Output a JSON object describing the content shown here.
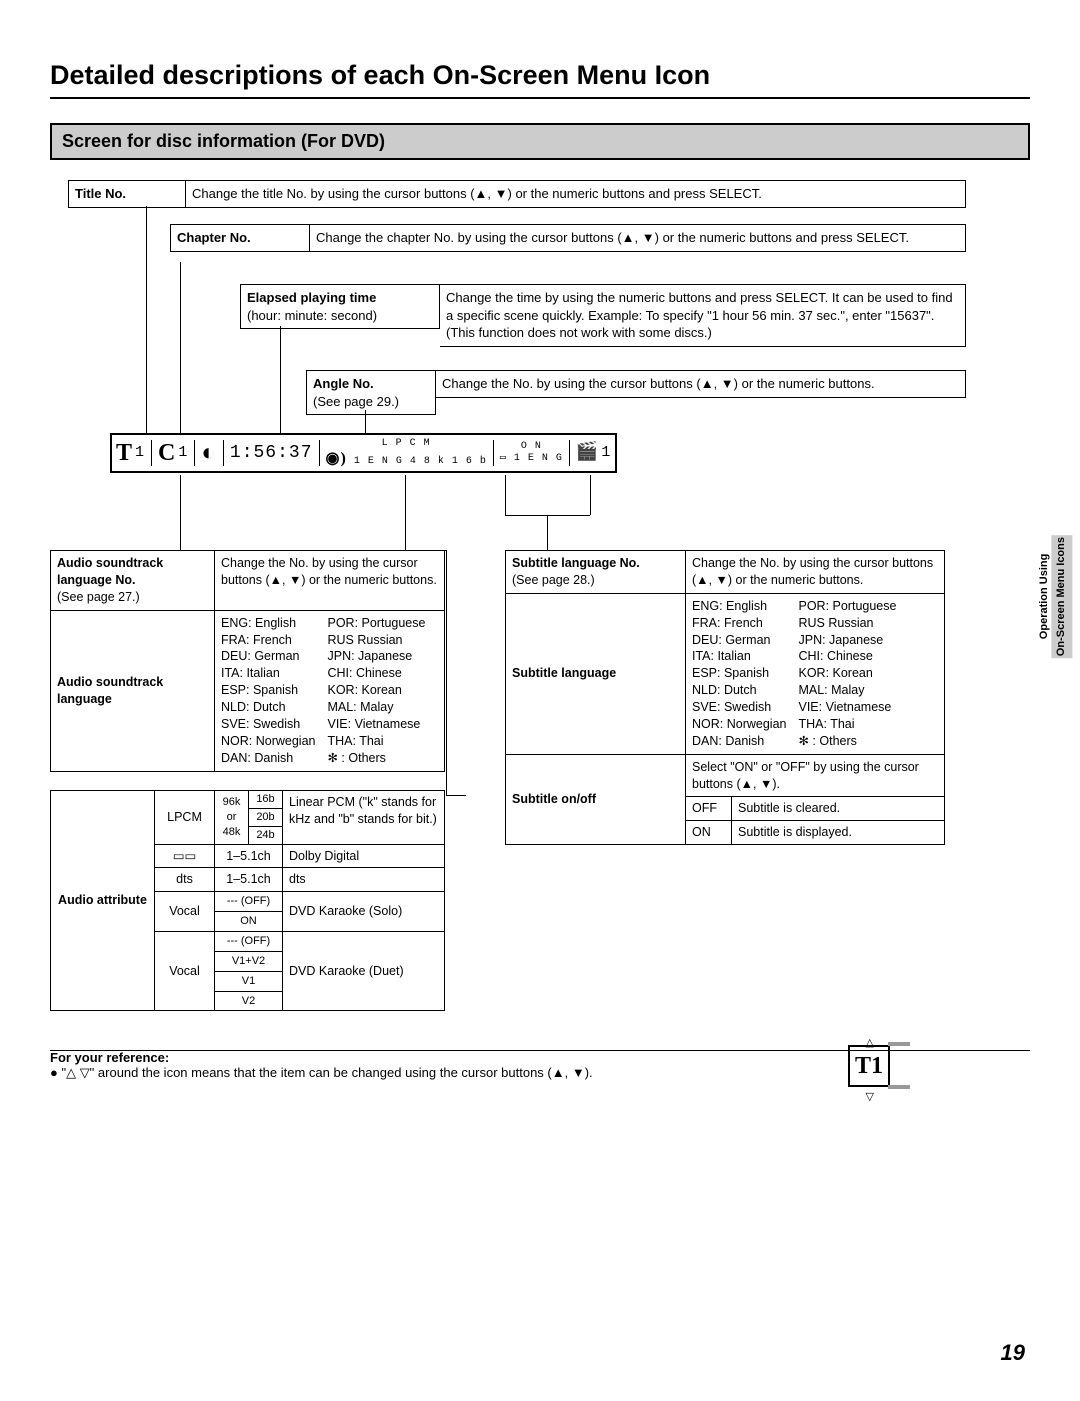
{
  "page_title": "Detailed descriptions of each On-Screen Menu Icon",
  "section_title": "Screen for disc information (For DVD)",
  "side_tab": {
    "line1": "Operation Using",
    "line2": "On-Screen Menu Icons"
  },
  "title_no": {
    "label": "Title No.",
    "desc": "Change the title No. by using the cursor buttons (▲, ▼) or the numeric buttons and press SELECT."
  },
  "chapter_no": {
    "label": "Chapter No.",
    "desc": "Change the chapter No. by using the cursor buttons (▲, ▼) or the numeric buttons and press SELECT."
  },
  "elapsed": {
    "label": "Elapsed playing time",
    "sub": "(hour: minute: second)",
    "desc": "Change the time by using the numeric buttons and press SELECT. It can be used to find a specific scene quickly. Example:  To specify \"1 hour 56 min. 37 sec.\", enter \"15637\". (This function does not work with some discs.)"
  },
  "angle": {
    "label": "Angle No.",
    "sub": "(See page 29.)",
    "desc": "Change the No. by using the cursor buttons (▲, ▼) or the numeric buttons."
  },
  "osd": {
    "t": "T",
    "t_val": "1",
    "c": "C",
    "c_val": "1",
    "angle_icon": "◐",
    "time": "1:56:37",
    "aud_icon": "◉)",
    "top_line": "L P C M",
    "aud_line": "1  E N G   4 8 k   1 6 b",
    "sub_on": "O N",
    "sub_lang": "1  E N G",
    "sub_icon": "▭",
    "s_val": "1"
  },
  "audio_no": {
    "label": "Audio soundtrack language No.",
    "sub": "(See page 27.)",
    "desc": "Change the No. by using the cursor buttons (▲, ▼) or the numeric buttons."
  },
  "audio_lang": {
    "label": "Audio soundtrack language"
  },
  "sub_no": {
    "label": "Subtitle language No.",
    "sub": "(See page 28.)",
    "desc": "Change the No. by using the cursor buttons (▲, ▼) or the numeric buttons."
  },
  "sub_lang": {
    "label": "Subtitle language"
  },
  "sub_onoff": {
    "label": "Subtitle on/off",
    "desc": "Select \"ON\" or \"OFF\" by using the cursor buttons (▲, ▼).",
    "off_row_a": "OFF",
    "off_row_b": "Subtitle is cleared.",
    "on_row_a": "ON",
    "on_row_b": "Subtitle is displayed."
  },
  "languages": {
    "col1": [
      "ENG: English",
      "FRA:  French",
      "DEU: German",
      "ITA:  Italian",
      "ESP:  Spanish",
      "NLD:  Dutch",
      "SVE:  Swedish",
      "NOR: Norwegian",
      "DAN: Danish"
    ],
    "col2": [
      "POR: Portuguese",
      "RUS  Russian",
      "JPN:  Japanese",
      "CHI:  Chinese",
      "KOR: Korean",
      "MAL: Malay",
      "VIE:  Vietnamese",
      "THA: Thai",
      "✻ :   Others"
    ]
  },
  "audio_attr": {
    "label": "Audio attribute",
    "lpcm_label": "LPCM",
    "lpcm_k1": "96k",
    "lpcm_or": "or",
    "lpcm_k2": "48k",
    "lpcm_b1": "16b",
    "lpcm_b2": "20b",
    "lpcm_b3": "24b",
    "lpcm_desc": "Linear PCM (\"k\" stands for kHz and \"b\" stands for bit.)",
    "dd_sym": "▭▭",
    "dd_ch": "1–5.1ch",
    "dd_name": "Dolby Digital",
    "dts_sym": "dts",
    "dts_ch": "1–5.1ch",
    "dts_name": "dts",
    "vocal1": "Vocal",
    "v1_off": "--- (OFF)",
    "v1_on": "ON",
    "solo": "DVD Karaoke (Solo)",
    "vocal2": "Vocal",
    "v2_off": "--- (OFF)",
    "v2_v12": "V1+V2",
    "v2_v1": "V1",
    "v2_v2": "V2",
    "duet": "DVD Karaoke (Duet)"
  },
  "footnote": {
    "head": "For your reference:",
    "body": "● \"△  ▽\" around the icon means that the item can be changed using the cursor buttons (▲, ▼)."
  },
  "ref_icon": "T1",
  "page_number": "19"
}
